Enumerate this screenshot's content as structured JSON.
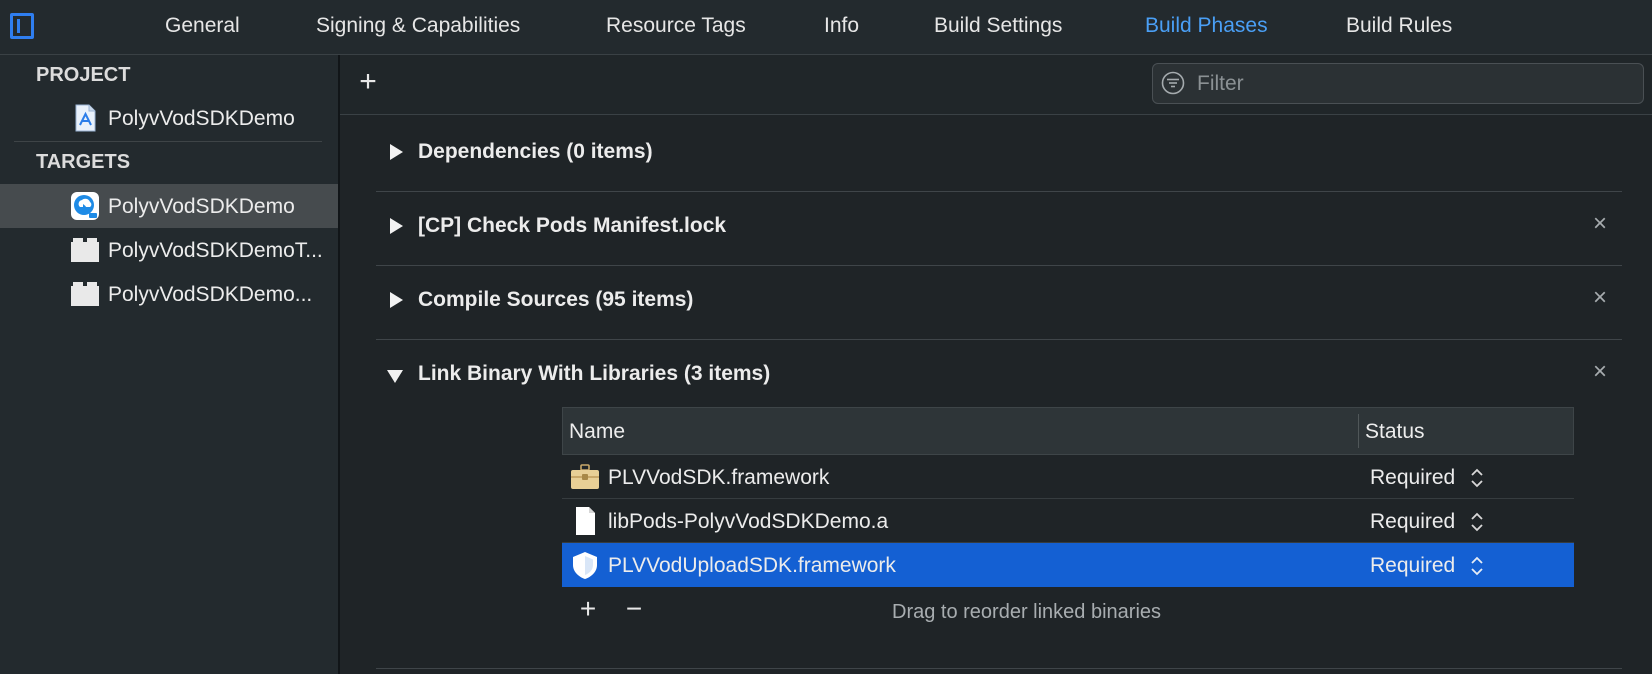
{
  "tabs": [
    {
      "label": "General",
      "active": false
    },
    {
      "label": "Signing & Capabilities",
      "active": false
    },
    {
      "label": "Resource Tags",
      "active": false
    },
    {
      "label": "Info",
      "active": false
    },
    {
      "label": "Build Settings",
      "active": false
    },
    {
      "label": "Build Phases",
      "active": true
    },
    {
      "label": "Build Rules",
      "active": false
    }
  ],
  "sidebar": {
    "project_header": "PROJECT",
    "project_item": {
      "label": "PolyvVodSDKDemo",
      "icon": "xcode-project-icon"
    },
    "targets_header": "TARGETS",
    "targets": [
      {
        "label": "PolyvVodSDKDemo",
        "icon": "app-icon",
        "selected": true
      },
      {
        "label": "PolyvVodSDKDemoT...",
        "icon": "test-bundle-icon",
        "selected": false
      },
      {
        "label": "PolyvVodSDKDemo...",
        "icon": "test-bundle-icon",
        "selected": false
      }
    ]
  },
  "toolbar": {
    "add_symbol": "+",
    "filter_placeholder": "Filter"
  },
  "phases": [
    {
      "title": "Dependencies (0 items)",
      "expanded": false,
      "removable": false
    },
    {
      "title": "[CP] Check Pods Manifest.lock",
      "expanded": false,
      "removable": true
    },
    {
      "title": "Compile Sources (95 items)",
      "expanded": false,
      "removable": true
    },
    {
      "title": "Link Binary With Libraries (3 items)",
      "expanded": true,
      "removable": true
    }
  ],
  "close_symbol": "×",
  "libraries": {
    "headers": {
      "name": "Name",
      "status": "Status"
    },
    "rows": [
      {
        "name": "PLVVodSDK.framework",
        "status": "Required",
        "icon": "framework-toolbox-icon",
        "selected": false
      },
      {
        "name": "libPods-PolyvVodSDKDemo.a",
        "status": "Required",
        "icon": "file-icon",
        "selected": false
      },
      {
        "name": "PLVVodUploadSDK.framework",
        "status": "Required",
        "icon": "framework-shield-icon",
        "selected": true
      }
    ],
    "footer": {
      "add_symbol": "+",
      "remove_symbol": "−",
      "hint": "Drag to reorder linked binaries"
    }
  },
  "colors": {
    "accent": "#4a9ff5",
    "selection": "#1460d3",
    "sidebar_selection": "#464b4e"
  }
}
